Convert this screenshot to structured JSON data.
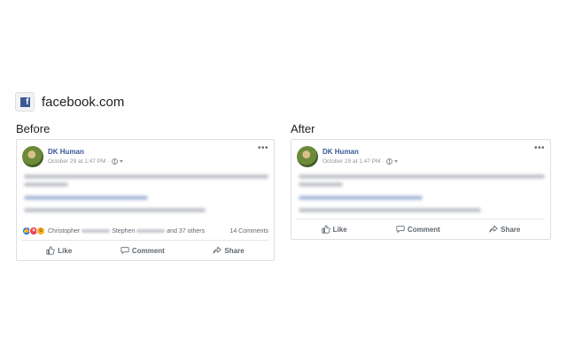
{
  "site": {
    "icon": "facebook-icon",
    "icon_glyph": "f",
    "name": "facebook.com"
  },
  "labels": {
    "before": "Before",
    "after": "After"
  },
  "post": {
    "author": "DK Human",
    "timestamp": "October 29 at 1:47 PM",
    "separator": "·",
    "privacy_icon": "globe-icon",
    "more_icon": "•••"
  },
  "before": {
    "reactions": {
      "first_name": "Christopher",
      "second_name": "Stephen",
      "others": "and 37 others",
      "comments": "14 Comments"
    },
    "actions": {
      "like": "Like",
      "comment": "Comment",
      "share": "Share"
    }
  },
  "after": {
    "actions": {
      "like": "Like",
      "comment": "Comment",
      "share": "Share"
    }
  },
  "colors": {
    "brand": "#3b5998",
    "link": "#385898",
    "like_reaction": "#1877f2",
    "love_reaction": "#f33e58",
    "wow_reaction": "#f7b125"
  }
}
